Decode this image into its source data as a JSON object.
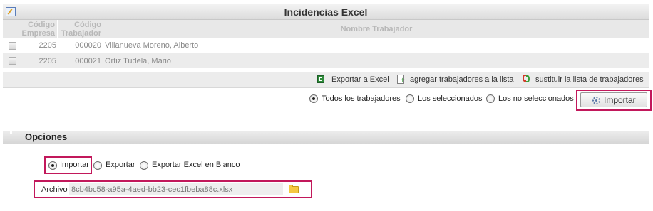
{
  "panel": {
    "title": "Incidencias Excel",
    "icon": "edit-sheet-icon"
  },
  "table": {
    "columns": {
      "empresa": [
        "Código",
        "Empresa"
      ],
      "trabajador": [
        "Código",
        "Trabajador"
      ],
      "nombre": "Nombre Trabajador"
    },
    "rows": [
      {
        "empresa": "2205",
        "trabajador": "000020",
        "nombre": "Villanueva Moreno, Alberto"
      },
      {
        "empresa": "2205",
        "trabajador": "000021",
        "nombre": "Ortiz Tudela, Mario"
      }
    ]
  },
  "toolbar": {
    "export_excel": "Exportar a Excel",
    "add_workers": "agregar trabajadores a la lista",
    "replace_list": "sustituir la lista de trabajadores"
  },
  "selection": {
    "options": [
      "Todos los trabajadores",
      "Los seleccionados",
      "Los no seleccionados"
    ],
    "selected": "Todos los trabajadores",
    "import_button": "Importar"
  },
  "options_section": {
    "title": "Opciones",
    "modes": [
      "Importar",
      "Exportar",
      "Exportar Excel en Blanco"
    ],
    "selected_mode": "Importar",
    "file_label": "Archivo",
    "file_value": "8cb4bc58-a95a-4aed-bb23-cec1fbeba88c.xlsx"
  },
  "colors": {
    "highlight": "#c2185b",
    "header_bg": "#dcdcdc",
    "row_alt": "#ececec"
  }
}
